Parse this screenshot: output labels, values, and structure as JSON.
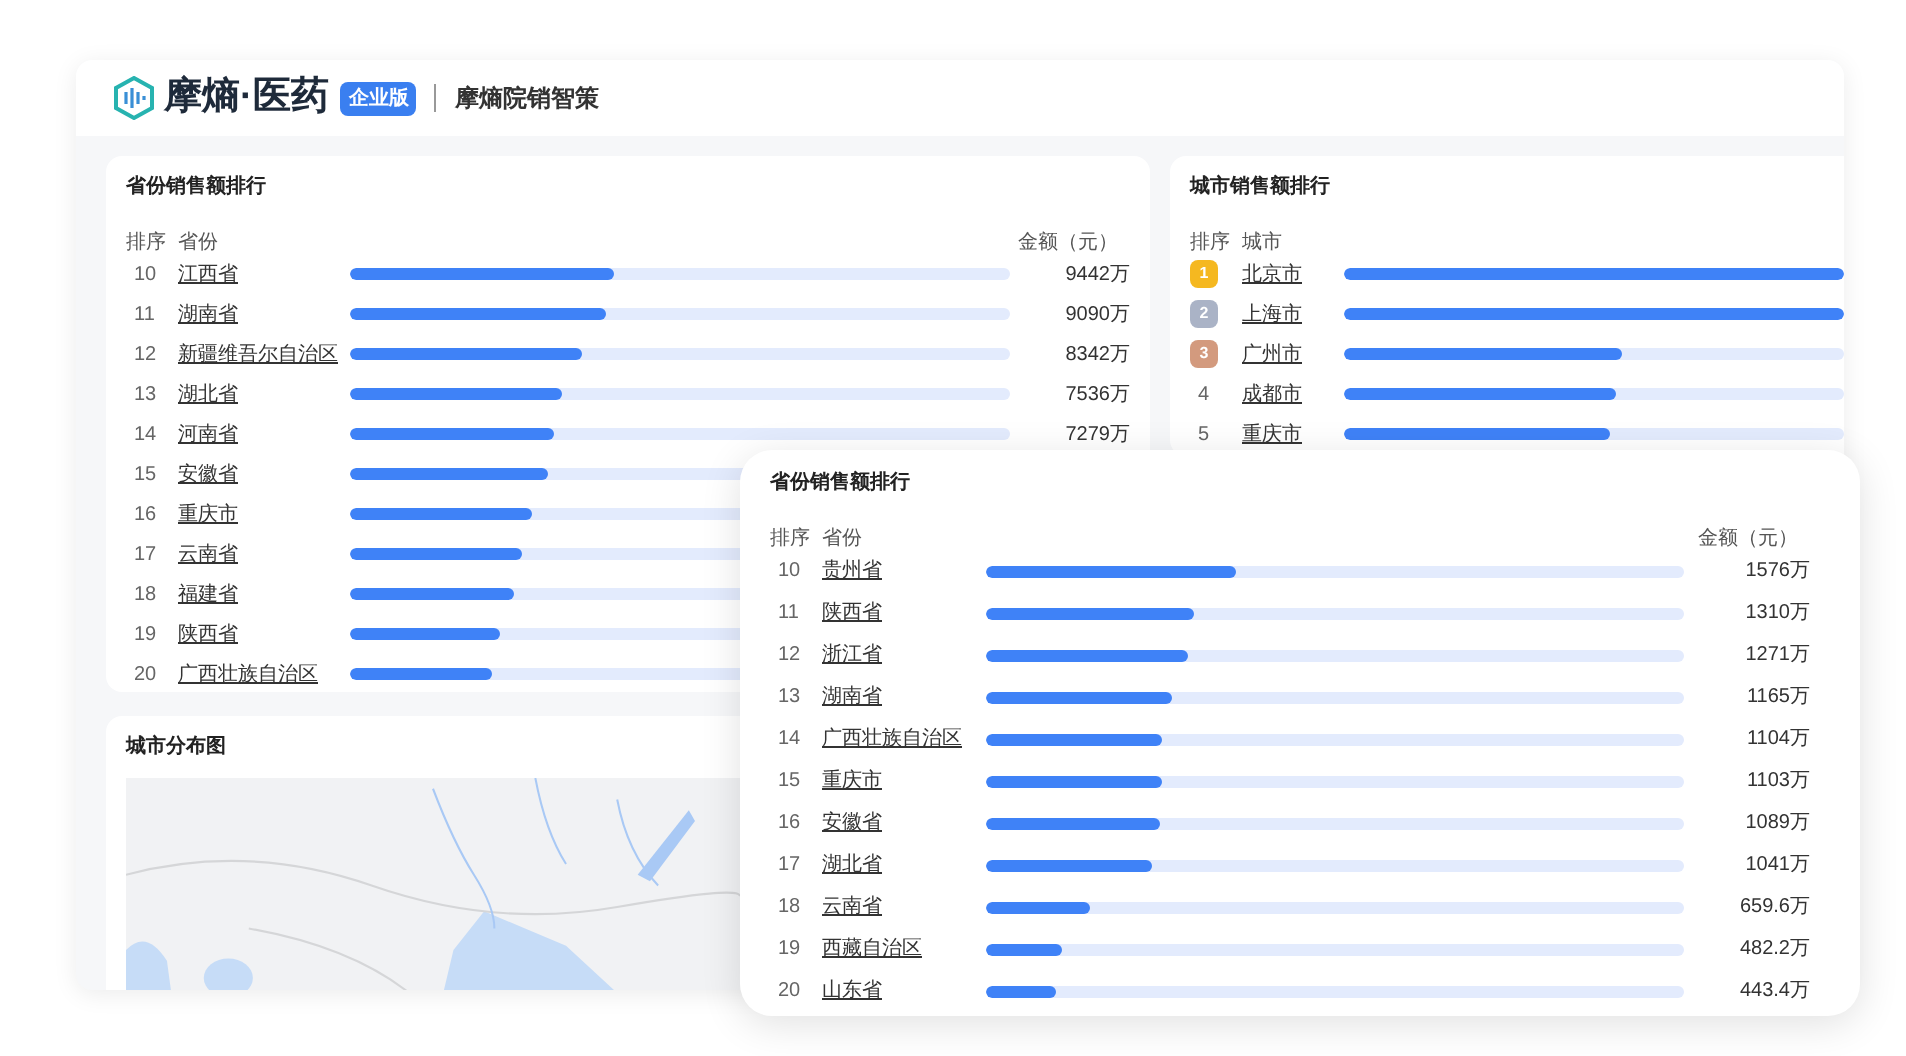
{
  "header": {
    "brand": "摩熵·医药",
    "badge": "企业版",
    "product": "摩熵院销智策"
  },
  "province_ranking": {
    "title": "省份销售额排行",
    "columns": [
      "排序",
      "省份",
      "金额（元）"
    ],
    "rows": [
      {
        "rank": "10",
        "name": "江西省",
        "level": 0.4,
        "amount": "9442万"
      },
      {
        "rank": "11",
        "name": "湖南省",
        "level": 0.387,
        "amount": "9090万"
      },
      {
        "rank": "12",
        "name": "新疆维吾尔自治区",
        "level": 0.353,
        "amount": "8342万"
      },
      {
        "rank": "13",
        "name": "湖北省",
        "level": 0.32,
        "amount": "7536万"
      },
      {
        "rank": "14",
        "name": "河南省",
        "level": 0.308,
        "amount": "7279万"
      },
      {
        "rank": "15",
        "name": "安徽省",
        "level": 0.299
      },
      {
        "rank": "16",
        "name": "重庆市",
        "level": 0.275
      },
      {
        "rank": "17",
        "name": "云南省",
        "level": 0.26
      },
      {
        "rank": "18",
        "name": "福建省",
        "level": 0.248
      },
      {
        "rank": "19",
        "name": "陕西省",
        "level": 0.227
      },
      {
        "rank": "20",
        "name": "广西壮族自治区",
        "level": 0.214
      }
    ]
  },
  "city_ranking": {
    "title": "城市销售额排行",
    "columns": [
      "排序",
      "城市"
    ],
    "rows": [
      {
        "kind": "medal",
        "color": "#f5b820",
        "rank": "1",
        "name": "北京市",
        "level": 1
      },
      {
        "kind": "medal",
        "color": "#aab3c6",
        "rank": "2",
        "name": "上海市",
        "level": 1
      },
      {
        "kind": "medal",
        "color": "#d39a7e",
        "rank": "3",
        "name": "广州市",
        "level": 0.557
      },
      {
        "kind": "plain",
        "rank": "4",
        "name": "成都市",
        "level": 0.545
      },
      {
        "kind": "plain",
        "rank": "5",
        "name": "重庆市",
        "level": 0.53
      }
    ]
  },
  "city_map": {
    "title": "城市分布图",
    "kind": "picture"
  },
  "overlay_ranking": {
    "title": "省份销售额排行",
    "columns": [
      "排序",
      "省份",
      "金额（元）"
    ],
    "rows": [
      {
        "rank": "10",
        "name": "贵州省",
        "level": 0.358,
        "amount": "1576万"
      },
      {
        "rank": "11",
        "name": "陕西省",
        "level": 0.298,
        "amount": "1310万"
      },
      {
        "rank": "12",
        "name": "浙江省",
        "level": 0.289,
        "amount": "1271万"
      },
      {
        "rank": "13",
        "name": "湖南省",
        "level": 0.266,
        "amount": "1165万"
      },
      {
        "rank": "14",
        "name": "广西壮族自治区",
        "level": 0.252,
        "amount": "1104万"
      },
      {
        "rank": "15",
        "name": "重庆市",
        "level": 0.252,
        "amount": "1103万"
      },
      {
        "rank": "16",
        "name": "安徽省",
        "level": 0.249,
        "amount": "1089万"
      },
      {
        "rank": "17",
        "name": "湖北省",
        "level": 0.238,
        "amount": "1041万"
      },
      {
        "rank": "18",
        "name": "云南省",
        "level": 0.149,
        "amount": "659.6万"
      },
      {
        "rank": "19",
        "name": "西藏自治区",
        "level": 0.109,
        "amount": "482.2万"
      },
      {
        "rank": "20",
        "name": "山东省",
        "level": 0.1,
        "amount": "443.4万"
      }
    ]
  }
}
